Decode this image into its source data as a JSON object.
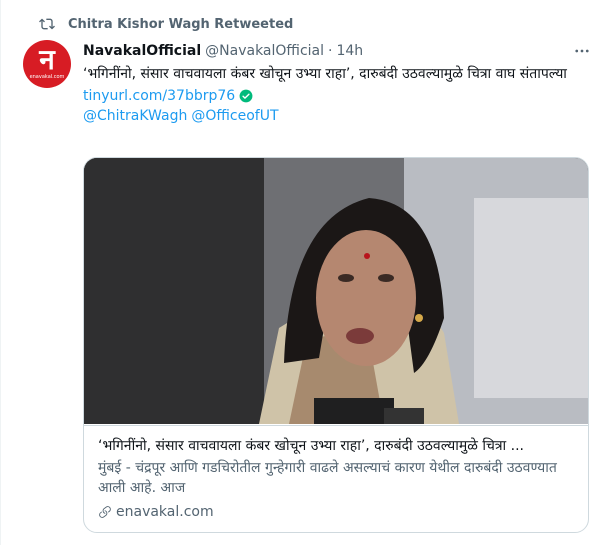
{
  "retweet": {
    "label": "Chitra Kishor Wagh Retweeted"
  },
  "avatar": {
    "glyph": "न",
    "caption": "enavakal.com"
  },
  "author": {
    "name": "NavakalOfficial",
    "handle": "@NavakalOfficial",
    "separator": "·",
    "time": "14h"
  },
  "tweet": {
    "text": "‘भगिनींनो, संसार वाचवायला कंबर खोचून उभ्या राहा’, दारुबंदी उठवल्यामुळे चित्रा वाघ संतापल्या",
    "link": "tinyurl.com/37bbrp76",
    "mentions": [
      "@ChitraKWagh",
      "@OfficeofUT"
    ]
  },
  "card": {
    "title": "‘भगिनींनो, संसार वाचवायला कंबर खोचून उभ्या राहा’, दारुबंदी उठवल्यामुळे चित्रा ...",
    "description": "मुंबई - चंद्रपूर आणि गडचिरोतील गुन्हेगारी वाढले असल्याचं कारण येथील दारुबंदी उठवण्यात आली आहे. आज",
    "domain": "enavakal.com"
  },
  "icons": {
    "retweet": "retweet-icon",
    "more": "more-icon",
    "verified": "verified-check-icon",
    "link": "link-icon"
  },
  "colors": {
    "accent": "#1d9bf0",
    "secondary": "#536471",
    "verified": "#00ba7c",
    "avatar": "#d71c24"
  }
}
